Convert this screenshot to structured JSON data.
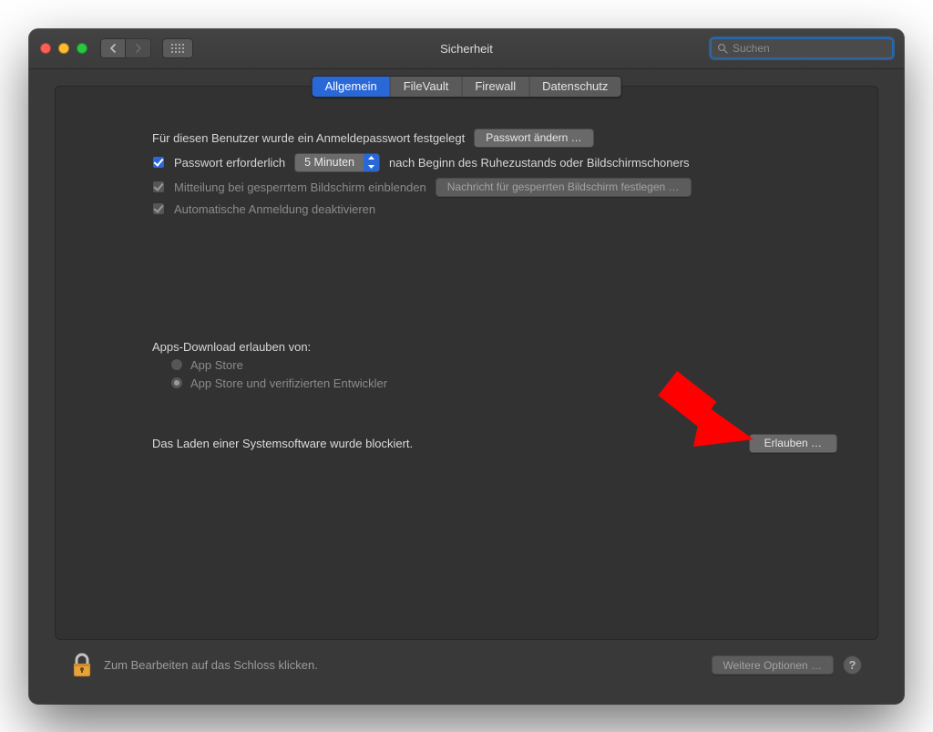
{
  "window": {
    "title": "Sicherheit"
  },
  "search": {
    "placeholder": "Suchen"
  },
  "tabs": {
    "general": "Allgemein",
    "filevault": "FileVault",
    "firewall": "Firewall",
    "privacy": "Datenschutz"
  },
  "login": {
    "password_set_text": "Für diesen Benutzer wurde ein Anmeldepasswort festgelegt",
    "change_password_btn": "Passwort ändern …",
    "require_password_label": "Passwort erforderlich",
    "require_password_delay": "5 Minuten",
    "require_password_after": "nach Beginn des Ruhezustands oder Bildschirmschoners",
    "lock_message_checkbox": "Mitteilung bei gesperrtem Bildschirm einblenden",
    "set_lock_message_btn": "Nachricht für gesperrten Bildschirm festlegen …",
    "disable_autologin": "Automatische Anmeldung deaktivieren"
  },
  "apps": {
    "heading": "Apps-Download erlauben von:",
    "option_appstore": "App Store",
    "option_identified": "App Store und verifizierten Entwickler"
  },
  "blocked": {
    "message": "Das Laden einer Systemsoftware wurde blockiert.",
    "allow_btn": "Erlauben …"
  },
  "footer": {
    "lock_hint": "Zum Bearbeiten auf das Schloss klicken.",
    "advanced_btn": "Weitere Optionen …"
  }
}
